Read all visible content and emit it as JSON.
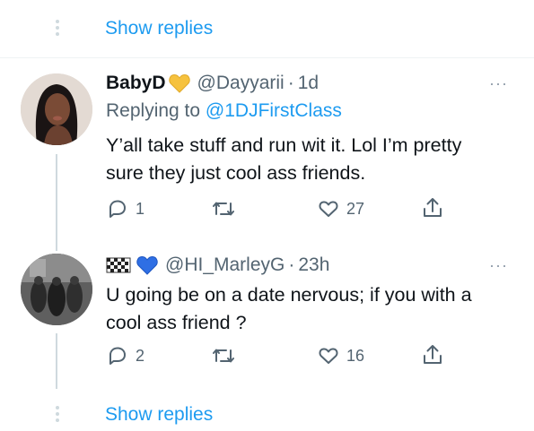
{
  "top": {
    "show_replies": "Show replies"
  },
  "reply1": {
    "name": "BabyD",
    "badge": "yellow-heart-emoji",
    "handle": "@Dayyarii",
    "sep": "·",
    "time": "1d",
    "replying_prefix": "Replying to",
    "replying_to": "@1DJFirstClass",
    "text_line1": "Y’all take stuff and run wit it. Lol I’m pretty",
    "text_line2": "sure they just cool ass friends.",
    "more": "···",
    "actions": {
      "replies": "1",
      "retweets": "",
      "likes": "27"
    }
  },
  "reply2": {
    "badges": [
      "checkered-flag-emoji",
      "blue-heart-emoji"
    ],
    "handle": "@HI_MarleyG",
    "sep": "·",
    "time": "23h",
    "text_line1": "U going be on a date nervous;  if you with a",
    "text_line2": "cool ass friend ?",
    "more": "···",
    "actions": {
      "replies": "2",
      "retweets": "",
      "likes": "16"
    }
  },
  "bottom": {
    "show_replies": "Show replies"
  },
  "colors": {
    "accent": "#1d9bf0",
    "secondary_text": "#536471",
    "divider": "#eff3f4"
  }
}
